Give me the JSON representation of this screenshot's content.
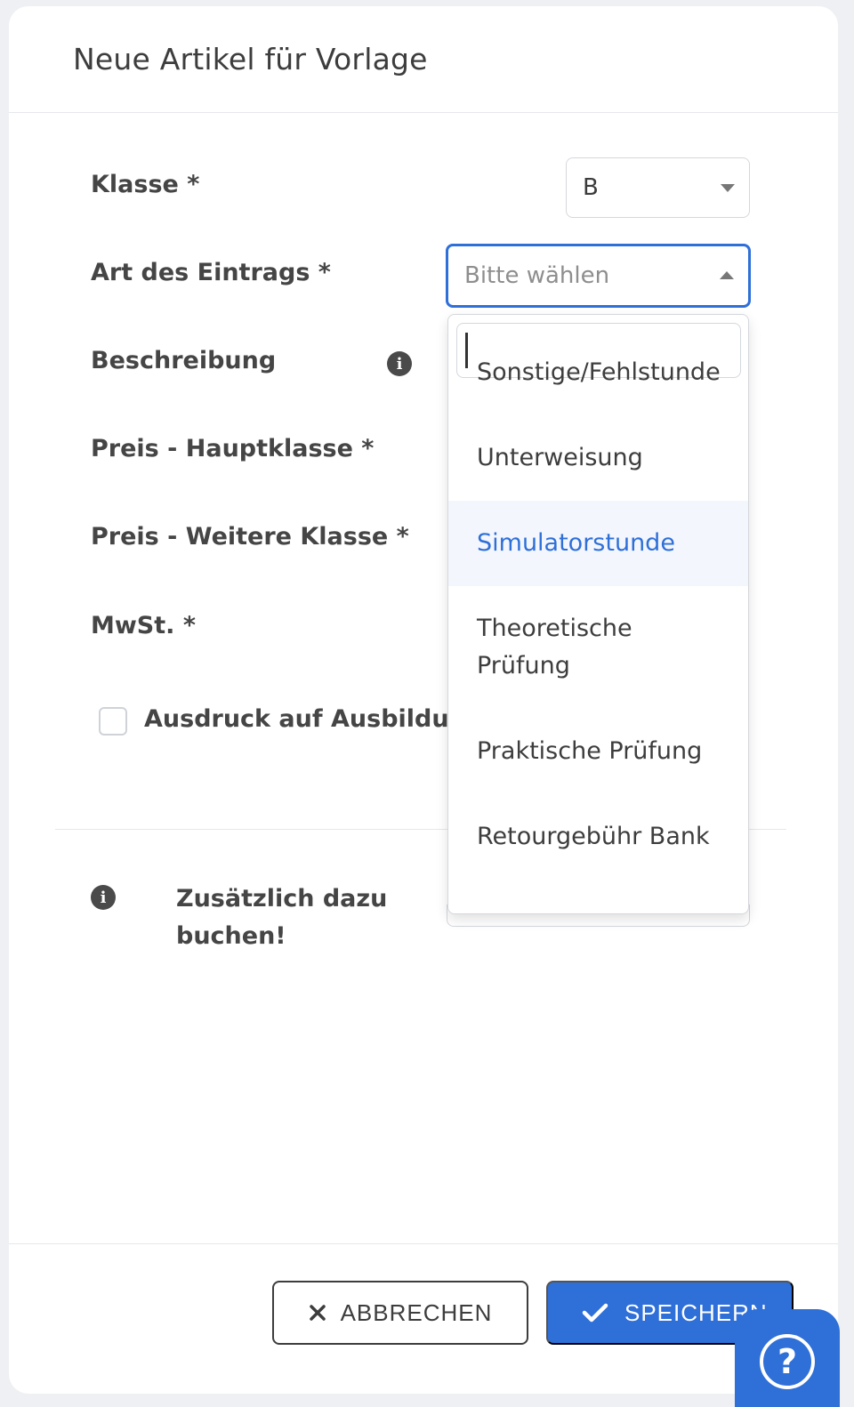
{
  "modal": {
    "title": "Neue Artikel für Vorlage"
  },
  "form": {
    "klasse_label": "Klasse *",
    "klasse_value": "B",
    "art_label": "Art des Eintrags *",
    "art_placeholder": "Bitte wählen",
    "beschreibung_label": "Beschreibung",
    "preis_haupt_label": "Preis - Hauptklasse *",
    "preis_weitere_label": "Preis - Weitere Klasse *",
    "mwst_label": "MwSt. *",
    "ausdruck_label": "Ausdruck auf Ausbildur",
    "ausdruck_checked": false
  },
  "extra": {
    "text": "Zusätzlich dazu buchen!"
  },
  "dropdown": {
    "search_value": "",
    "options": [
      {
        "label": "Sonstige/Fehlstunde",
        "active": false
      },
      {
        "label": "Unterweisung",
        "active": false
      },
      {
        "label": "Simulatorstunde",
        "active": true
      },
      {
        "label": "Theoretische Prüfung",
        "active": false
      },
      {
        "label": "Praktische Prüfung",
        "active": false
      },
      {
        "label": "Retourgebühr Bank",
        "active": false
      }
    ]
  },
  "footer": {
    "cancel_label": "ABBRECHEN",
    "save_label": "SPEICHERN"
  },
  "help": {
    "label": "?"
  },
  "icons": {
    "info": "info-icon",
    "close": "close-icon",
    "check": "check-icon",
    "help": "help-chat-icon"
  },
  "colors": {
    "accent": "#2f6fd8",
    "active_bg": "#f3f7fd"
  }
}
